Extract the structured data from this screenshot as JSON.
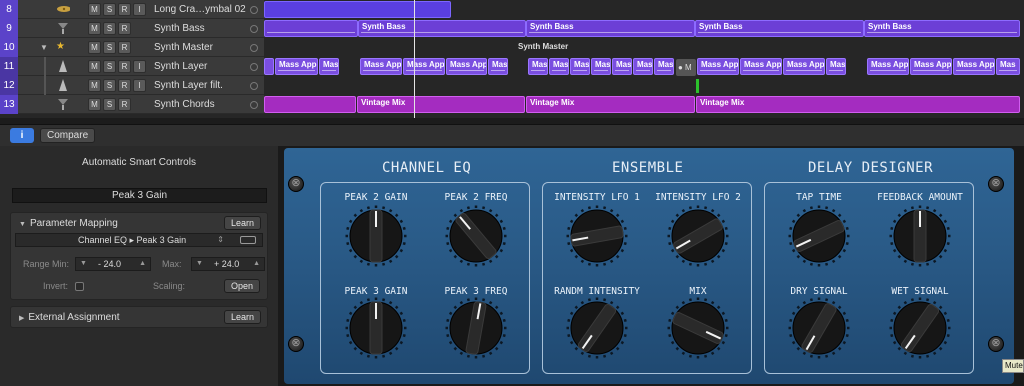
{
  "tracks": [
    {
      "num": "8",
      "name": "Long Cra…ymbal 02",
      "icon": "cymbal-icon",
      "msr": [
        "M",
        "S",
        "R",
        "I"
      ]
    },
    {
      "num": "9",
      "name": "Synth Bass",
      "icon": "synth-icon",
      "msr": [
        "M",
        "S",
        "R"
      ]
    },
    {
      "num": "10",
      "name": "Synth Master",
      "icon": "star-icon",
      "msr": [
        "M",
        "S",
        "R"
      ]
    },
    {
      "num": "11",
      "name": "Synth Layer",
      "icon": "synth-icon",
      "msr": [
        "M",
        "S",
        "R",
        "I"
      ]
    },
    {
      "num": "12",
      "name": "Synth Layer filt.",
      "icon": "synth-icon",
      "msr": [
        "M",
        "S",
        "R",
        "I"
      ]
    },
    {
      "num": "13",
      "name": "Synth Chords",
      "icon": "synth-icon",
      "msr": [
        "M",
        "S",
        "R"
      ]
    }
  ],
  "regions": {
    "synth_bass": [
      "Synth Bass",
      "Synth Bass",
      "Synth Bass",
      "Synth Bass"
    ],
    "synth_master": "Synth Master",
    "mass_app": "Mass App",
    "mass_short": "Mas",
    "vintage_mix": [
      "Vintage Mix",
      "Vintage Mix",
      "Vintage Mix"
    ],
    "grey_region": "● M"
  },
  "toolbar": {
    "info_label": "i",
    "compare_label": "Compare"
  },
  "inspector": {
    "title": "Automatic Smart Controls",
    "parameter_name": "Peak 3 Gain",
    "mapping_header": "Parameter Mapping",
    "learn_label": "Learn",
    "mapping_target": "Channel EQ ▸ Peak 3 Gain",
    "range_min_label": "Range Min:",
    "range_min_value": "- 24.0",
    "max_label": "Max:",
    "max_value": "+ 24.0",
    "invert_label": "Invert:",
    "scaling_label": "Scaling:",
    "open_label": "Open",
    "external_header": "External Assignment",
    "external_learn_label": "Learn"
  },
  "panel": {
    "sections": [
      "CHANNEL EQ",
      "ENSEMBLE",
      "DELAY DESIGNER"
    ],
    "knobs": [
      {
        "label": "PEAK 2 GAIN",
        "angle": 0
      },
      {
        "label": "PEAK 2 FREQ",
        "angle": -40
      },
      {
        "label": "INTENSITY LFO 1",
        "angle": -100
      },
      {
        "label": "INTENSITY LFO 2",
        "angle": -120
      },
      {
        "label": "TAP TIME",
        "angle": -115
      },
      {
        "label": "FEEDBACK AMOUNT",
        "angle": 0
      },
      {
        "label": "PEAK 3 GAIN",
        "angle": 0
      },
      {
        "label": "PEAK 3 FREQ",
        "angle": 10
      },
      {
        "label": "RANDM INTENSITY",
        "angle": -145
      },
      {
        "label": "MIX",
        "angle": 115
      },
      {
        "label": "DRY SIGNAL",
        "angle": -150
      },
      {
        "label": "WET SIGNAL",
        "angle": -145
      }
    ]
  },
  "tooltip": "Mute",
  "colors": {
    "accent": "#5b43c9",
    "panel_blue": "#2a5b88",
    "region_magenta": "#a42cc0"
  }
}
